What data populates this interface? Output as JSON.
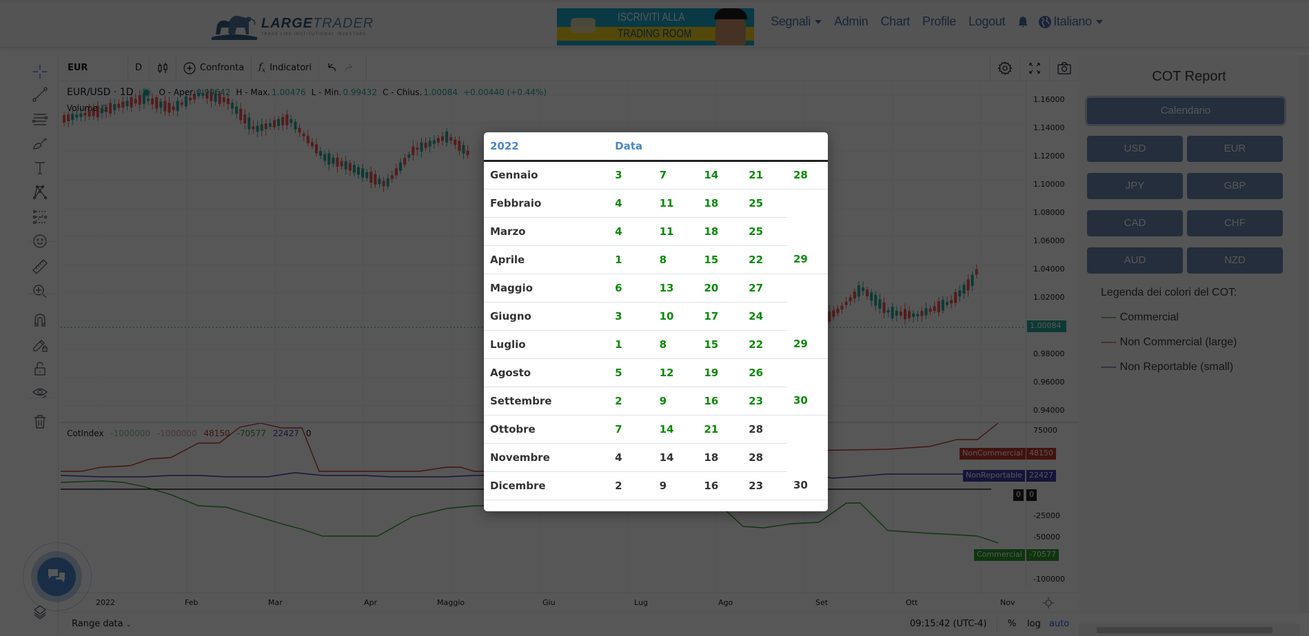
{
  "nav": {
    "logo": {
      "bold": "LARGE",
      "light": "TRADER",
      "tagline": "TRADE LIKE INSTITUTIONAL INVESTORS"
    },
    "banner": {
      "line1": "ISCRIVITI ALLA",
      "line2": "TRADING ROOM"
    },
    "links": [
      {
        "label": "Segnali",
        "dropdown": true
      },
      {
        "label": "Admin",
        "dropdown": false
      },
      {
        "label": "Chart",
        "dropdown": false
      },
      {
        "label": "Profile",
        "dropdown": false
      },
      {
        "label": "Logout",
        "dropdown": false
      }
    ],
    "notifications_icon": "bell-icon",
    "language": {
      "icon": "globe-icon",
      "label": "Italiano"
    }
  },
  "chart_toolbar": {
    "symbol": "EUR",
    "interval": "D",
    "chart_type_icon": "candles-icon",
    "compare_label": "Confronta",
    "indicators_label": "Indicatori",
    "right_icons": [
      "gear-icon",
      "fullscreen-icon",
      "camera-icon"
    ]
  },
  "left_tools": [
    "crosshair-icon",
    "trendline-icon",
    "horizontal-lines-icon",
    "brush-icon",
    "text-icon",
    "pattern-icon",
    "forecast-icon",
    "emoji-icon",
    "ruler-icon",
    "zoom-in-icon",
    "magnet-icon",
    "pencil-lock-icon",
    "lock-icon",
    "eye-icon",
    "trash-icon"
  ],
  "legend": {
    "pair": "EUR/USD · 1D",
    "open_label": "O - Aper.",
    "open": "0.99642",
    "high_label": "H - Max.",
    "high": "1.00476",
    "low_label": "L - Min.",
    "low": "0.99432",
    "close_label": "C - Chius.",
    "close": "1.00084",
    "change": "+0.00440 (+0.44%)",
    "volume_label": "Volume",
    "volume": "0"
  },
  "price_axis": {
    "ticks": [
      "1.16000",
      "1.14000",
      "1.12000",
      "1.10000",
      "1.08000",
      "1.06000",
      "1.04000",
      "1.02000",
      "0.98000",
      "0.96000",
      "0.94000"
    ],
    "last_price": "1.00084"
  },
  "cot_pane": {
    "title": "CotIndex",
    "values": [
      "-1000000",
      "-1000000",
      "48150",
      "-70577",
      "22427",
      "0"
    ],
    "ticks": [
      "75000",
      "-25000",
      "-50000",
      "-100000"
    ],
    "tags": {
      "noncommercial": {
        "label": "NonCommercial",
        "value": "48150",
        "color": "#c0392b"
      },
      "nonreportable": {
        "label": "NonReportable",
        "value": "22427",
        "color": "#3f3fa6"
      },
      "zero": {
        "label": "0",
        "value": "0",
        "color": "#222222"
      },
      "commercial": {
        "label": "Commercial",
        "value": "-70577",
        "color": "#2e9b2e"
      }
    }
  },
  "time_axis": [
    "2022",
    "Feb",
    "Mar",
    "Apr",
    "Maggio",
    "Giu",
    "Lug",
    "Ago",
    "Set",
    "Ott",
    "Nov"
  ],
  "bottom_bar": {
    "range_label": "Range data",
    "clock": "09:15:42 (UTC-4)",
    "percent": "%",
    "log": "log",
    "auto": "auto"
  },
  "right_panel": {
    "title": "COT Report",
    "calendar_button": "Calendario",
    "currencies": [
      "USD",
      "EUR",
      "JPY",
      "GBP",
      "CAD",
      "CHF",
      "AUD",
      "NZD"
    ],
    "legend_title": "Legenda dei colori del COT:",
    "legend": [
      {
        "dash": "-----",
        "label": "Commercial",
        "color": "#2e9b2e"
      },
      {
        "dash": "-----",
        "label": "Non Commercial (large)",
        "color": "#c0392b"
      },
      {
        "dash": "-----",
        "label": "Non Reportable (small)",
        "color": "#3f3fa6"
      }
    ]
  },
  "modal": {
    "year": "2022",
    "date_header": "Data",
    "months": [
      {
        "name": "Gennaio",
        "dates": [
          "3",
          "7",
          "14",
          "21",
          "28"
        ],
        "status": "published"
      },
      {
        "name": "Febbraio",
        "dates": [
          "4",
          "11",
          "18",
          "25"
        ],
        "status": "published"
      },
      {
        "name": "Marzo",
        "dates": [
          "4",
          "11",
          "18",
          "25"
        ],
        "status": "published"
      },
      {
        "name": "Aprile",
        "dates": [
          "1",
          "8",
          "15",
          "22",
          "29"
        ],
        "status": "published"
      },
      {
        "name": "Maggio",
        "dates": [
          "6",
          "13",
          "20",
          "27"
        ],
        "status": "published"
      },
      {
        "name": "Giugno",
        "dates": [
          "3",
          "10",
          "17",
          "24"
        ],
        "status": "published"
      },
      {
        "name": "Luglio",
        "dates": [
          "1",
          "8",
          "15",
          "22",
          "29"
        ],
        "status": "published"
      },
      {
        "name": "Agosto",
        "dates": [
          "5",
          "12",
          "19",
          "26"
        ],
        "status": "published"
      },
      {
        "name": "Settembre",
        "dates": [
          "2",
          "9",
          "16",
          "23",
          "30"
        ],
        "status": "published"
      },
      {
        "name": "Ottobre",
        "dates": [
          "7",
          "14",
          "21",
          "28"
        ],
        "status": "partial",
        "published_count": 3
      },
      {
        "name": "Novembre",
        "dates": [
          "4",
          "14",
          "18",
          "28"
        ],
        "status": "upcoming"
      },
      {
        "name": "Dicembre",
        "dates": [
          "2",
          "9",
          "16",
          "23",
          "30"
        ],
        "status": "upcoming"
      }
    ],
    "colors": {
      "published": "#0a8a0a",
      "upcoming": "#333333",
      "header": "#4a86c5"
    }
  },
  "chat_icon": "chat-bubbles-icon"
}
